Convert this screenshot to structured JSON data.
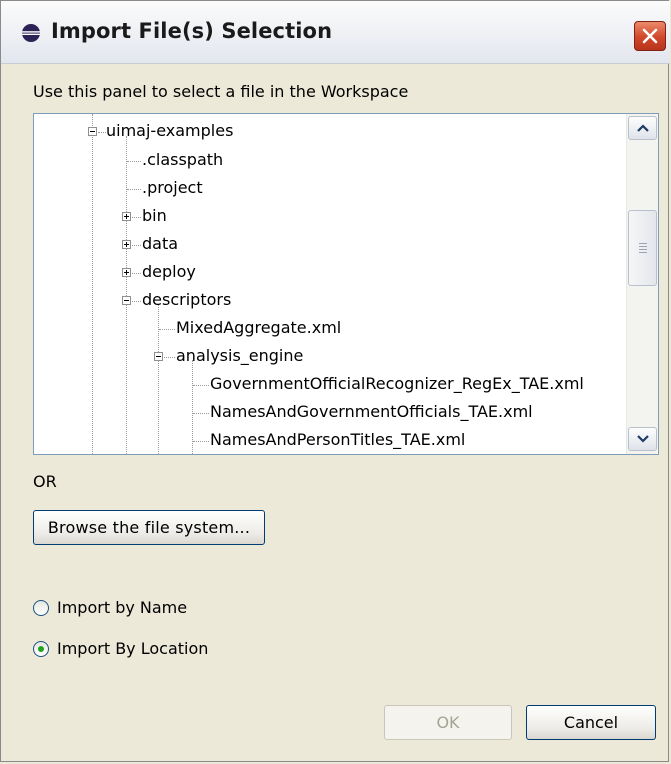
{
  "window": {
    "title": "Import File(s) Selection",
    "icon": "eclipse-icon",
    "close_icon": "close-icon"
  },
  "instructions": "Use this panel to select a file in the Workspace",
  "tree": {
    "items": [
      {
        "label": "uimaj-examples",
        "expander": "minus"
      },
      {
        "label": ".classpath",
        "expander": "none"
      },
      {
        "label": ".project",
        "expander": "none"
      },
      {
        "label": "bin",
        "expander": "plus"
      },
      {
        "label": "data",
        "expander": "plus"
      },
      {
        "label": "deploy",
        "expander": "plus"
      },
      {
        "label": "descriptors",
        "expander": "minus"
      },
      {
        "label": "MixedAggregate.xml",
        "expander": "none"
      },
      {
        "label": "analysis_engine",
        "expander": "minus"
      },
      {
        "label": "GovernmentOfficialRecognizer_RegEx_TAE.xml",
        "expander": "none"
      },
      {
        "label": "NamesAndGovernmentOfficials_TAE.xml",
        "expander": "none"
      },
      {
        "label": "NamesAndPersonTitles_TAE.xml",
        "expander": "none"
      }
    ]
  },
  "or_label": "OR",
  "browse_label": "Browse the file system...",
  "radios": {
    "by_name": {
      "label": "Import by Name",
      "checked": false
    },
    "by_location": {
      "label": "Import By Location",
      "checked": true
    }
  },
  "buttons": {
    "ok": "OK",
    "cancel": "Cancel"
  },
  "colors": {
    "dialog_bg": "#ece9d8",
    "close_button": "#d1472a",
    "radio_checked": "#21a121",
    "button_border": "#003c74"
  }
}
